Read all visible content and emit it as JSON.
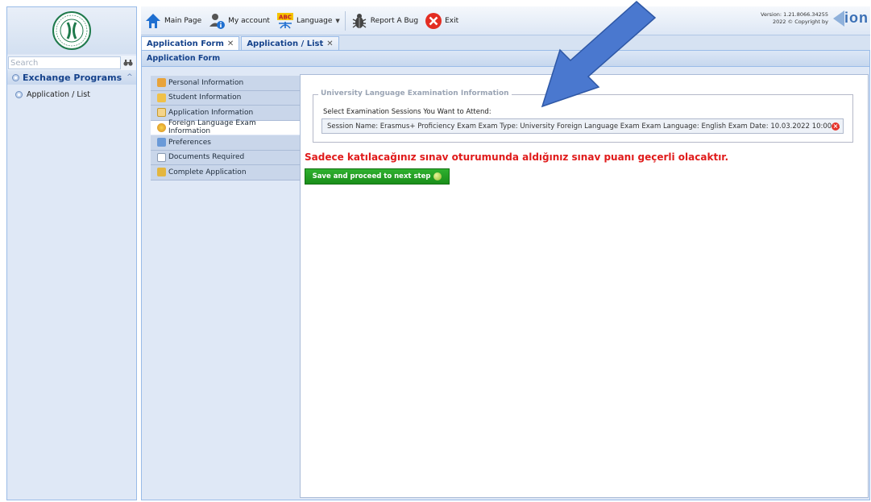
{
  "colors": {
    "sidebar_bg": "#dfe8f6",
    "accent_blue": "#15428b",
    "warning_red": "#e01b1b",
    "save_green": "#1a8e1a",
    "arrow_blue": "#3f6fc9"
  },
  "sidebar": {
    "search_placeholder": "Search",
    "search_icon": "binoculars-icon",
    "module_title": "Exchange Programs",
    "items": [
      {
        "label": "Application / List",
        "icon": "circle-icon"
      }
    ]
  },
  "toolbar": {
    "buttons": [
      {
        "label": "Main Page",
        "icon": "home-icon"
      },
      {
        "label": "My account",
        "icon": "user-info-icon"
      },
      {
        "label": "Language",
        "icon": "language-abc-icon"
      },
      {
        "label": "Report A Bug",
        "icon": "bug-icon"
      },
      {
        "label": "Exit",
        "icon": "exit-icon"
      }
    ],
    "version_line1": "Version: 1.21.8066.34255",
    "version_line2": "2022 © Copyright by",
    "brand": "ion"
  },
  "tabs": [
    {
      "label": "Application Form",
      "active": true
    },
    {
      "label": "Application / List",
      "active": false
    }
  ],
  "panel": {
    "title": "Application Form",
    "steps": [
      {
        "label": "Personal Information",
        "icon": "person-edit-icon"
      },
      {
        "label": "Student Information",
        "icon": "student-edit-icon"
      },
      {
        "label": "Application Information",
        "icon": "document-icon"
      },
      {
        "label": "Foreign Language Exam Information",
        "icon": "language-icon",
        "active": true
      },
      {
        "label": "Preferences",
        "icon": "preferences-icon"
      },
      {
        "label": "Documents Required",
        "icon": "add-document-icon"
      },
      {
        "label": "Complete Application",
        "icon": "complete-icon"
      }
    ],
    "fieldset_legend": "University Language Examination Information",
    "select_label": "Select Examination Sessions You Want to Attend:",
    "session_text": "Session Name: Erasmus+ Proficiency Exam Exam Type: University Foreign Language Exam Exam Language: English Exam Date: 10.03.2022 10:00 ...",
    "warning": "Sadece katılacağınız sınav oturumunda aldığınız sınav puanı geçerli olacaktır.",
    "save_button": "Save and proceed to next step"
  }
}
